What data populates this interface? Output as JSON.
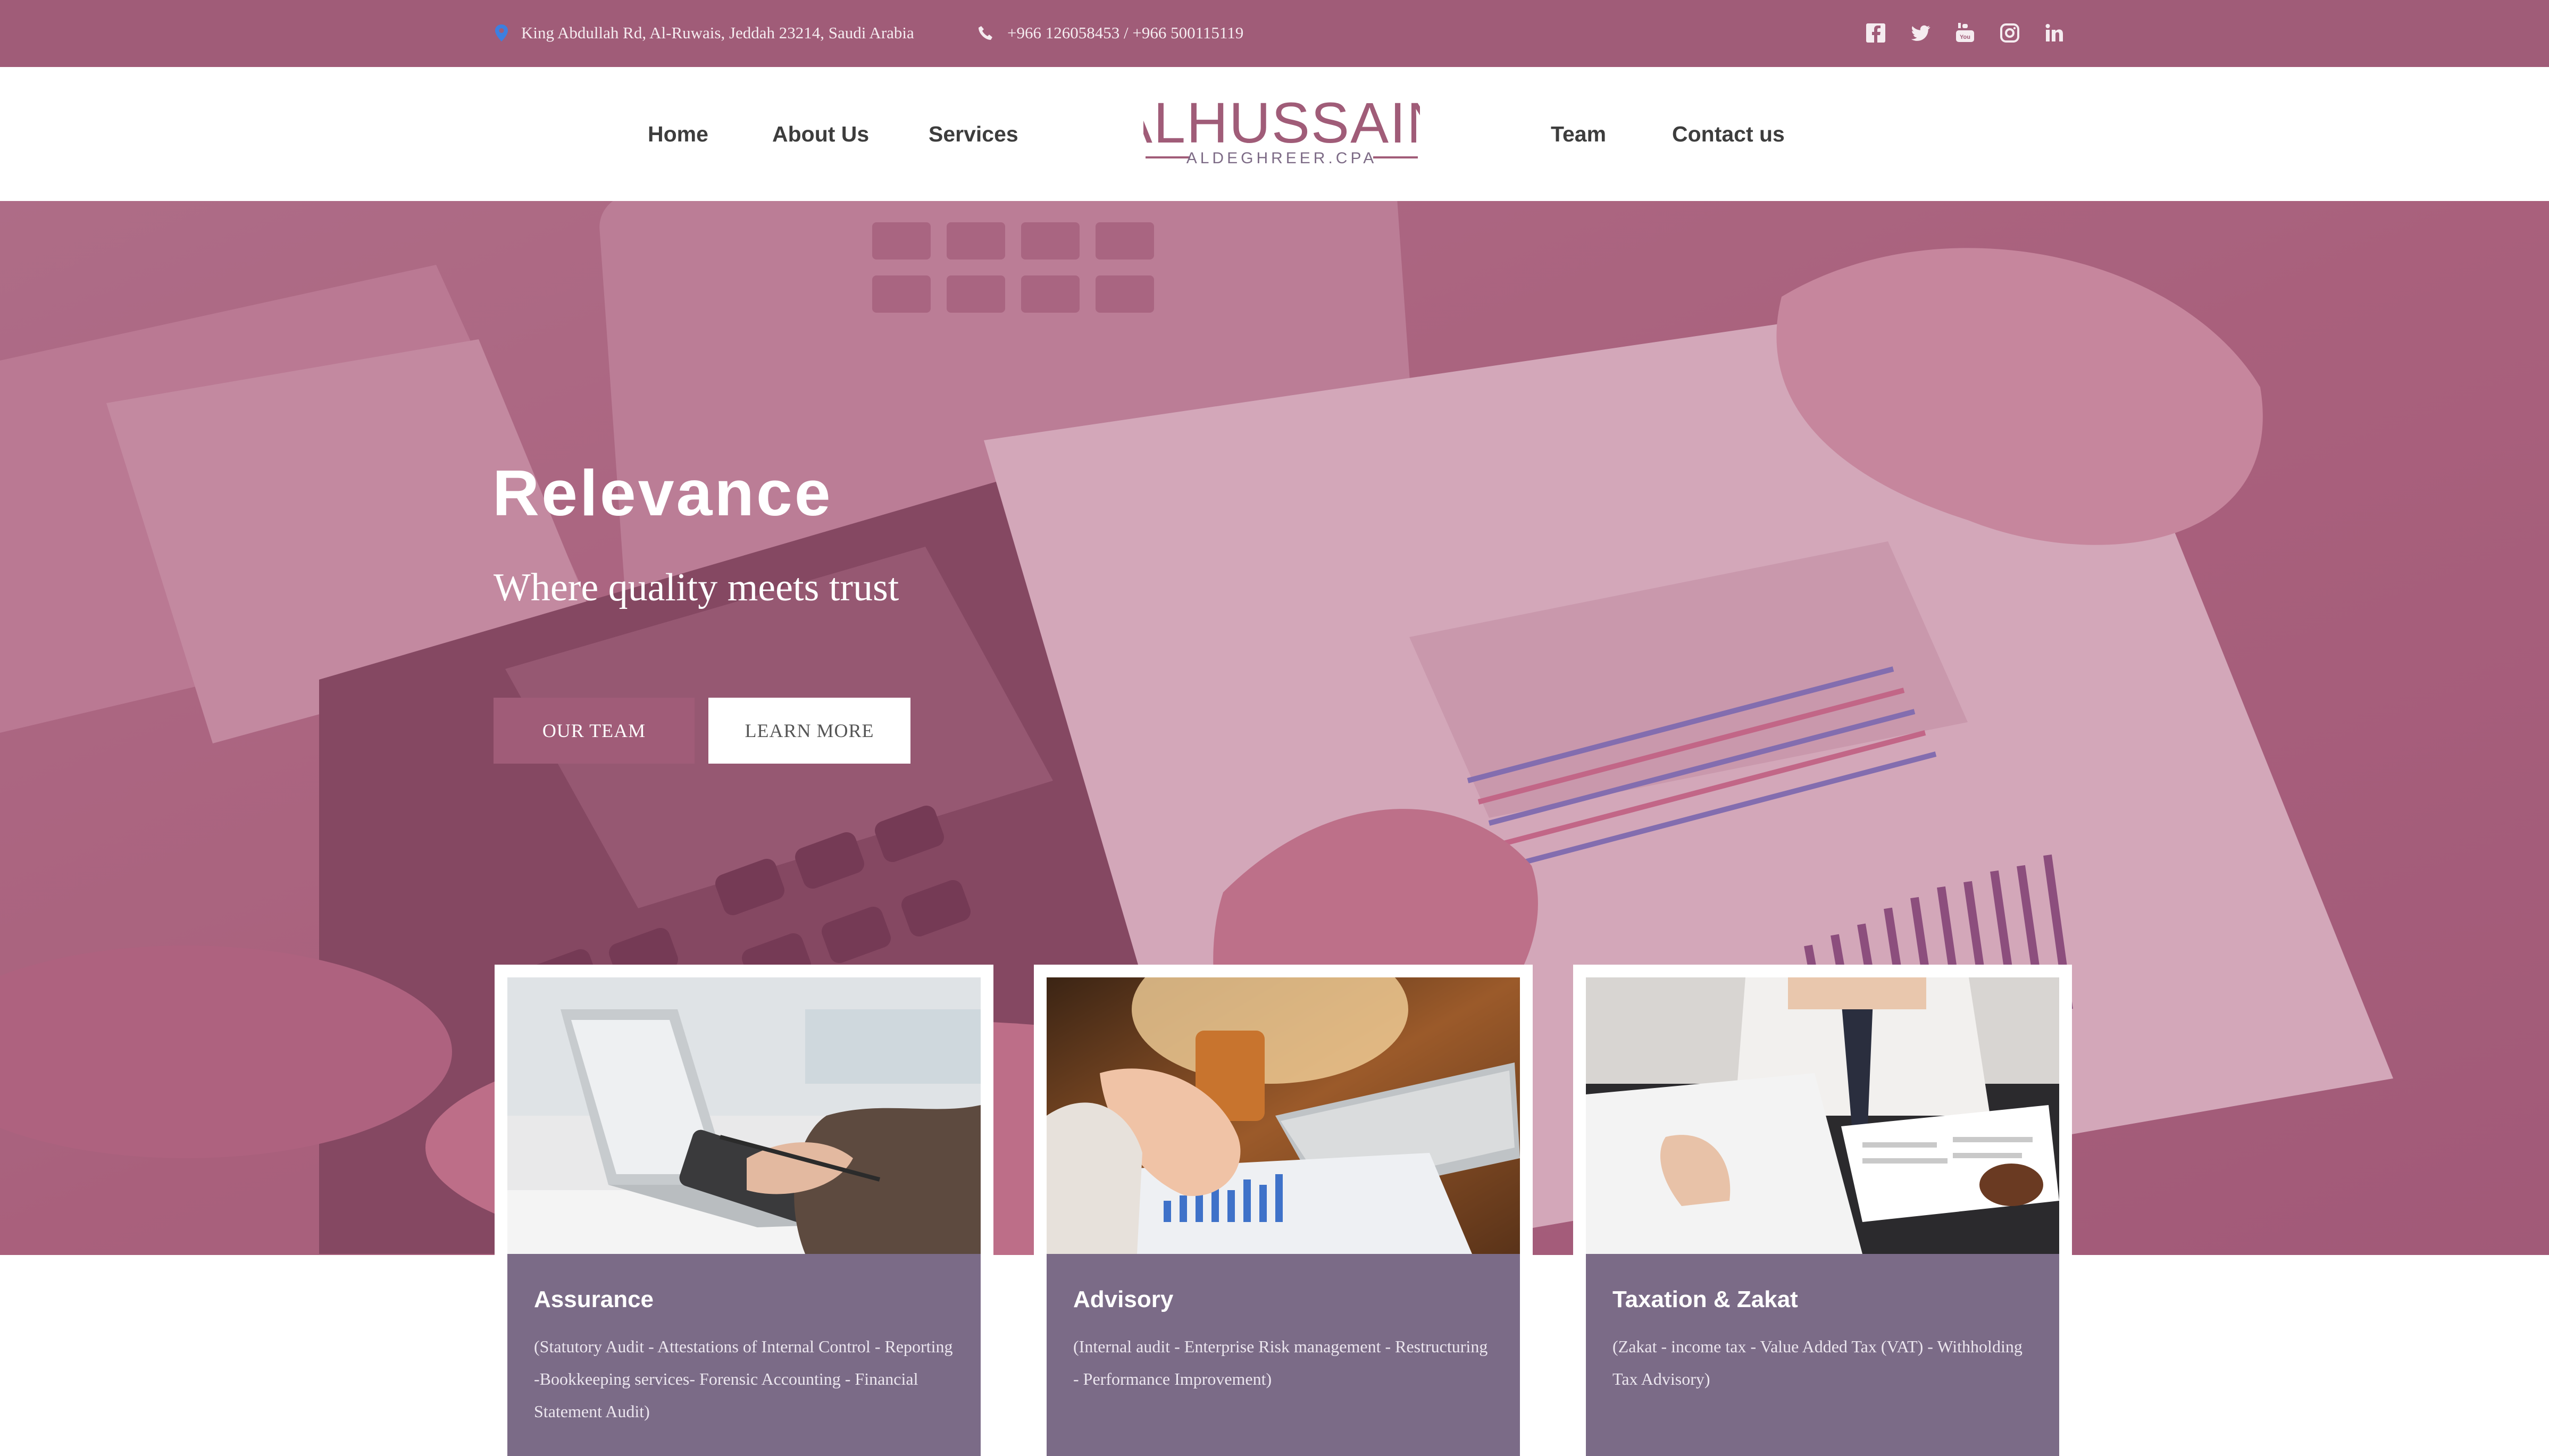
{
  "topbar": {
    "address": "King Abdullah Rd, Al-Ruwais, Jeddah 23214, Saudi Arabia",
    "phone": "+966 126058453 / +966 500115119",
    "socials": [
      "facebook-icon",
      "twitter-icon",
      "youtube-icon",
      "instagram-icon",
      "linkedin-icon"
    ]
  },
  "nav": {
    "home": "Home",
    "about": "About Us",
    "services": "Services",
    "team": "Team",
    "contact": "Contact us"
  },
  "logo": {
    "main": "ALHUSSAIN",
    "sub": "ALDEGHREER.CPA"
  },
  "hero": {
    "title": "Relevance",
    "subtitle": "Where quality meets trust",
    "btn_primary": "OUR TEAM",
    "btn_secondary": "LEARN MORE"
  },
  "cards": [
    {
      "title": "Assurance",
      "text": "(Statutory Audit - Attestations of Internal Control - Reporting -Bookkeeping services- Forensic Accounting - Financial Statement Audit)"
    },
    {
      "title": "Advisory",
      "text": "(Internal audit - Enterprise Risk management - Restructuring - Performance Improvement)"
    },
    {
      "title": "Taxation & Zakat",
      "text": "(Zakat - income tax - Value Added Tax (VAT) - Withholding Tax Advisory)"
    }
  ],
  "colors": {
    "brand": "#a05c78",
    "card_info": "#7b6b87",
    "overlay": "#c07894"
  }
}
